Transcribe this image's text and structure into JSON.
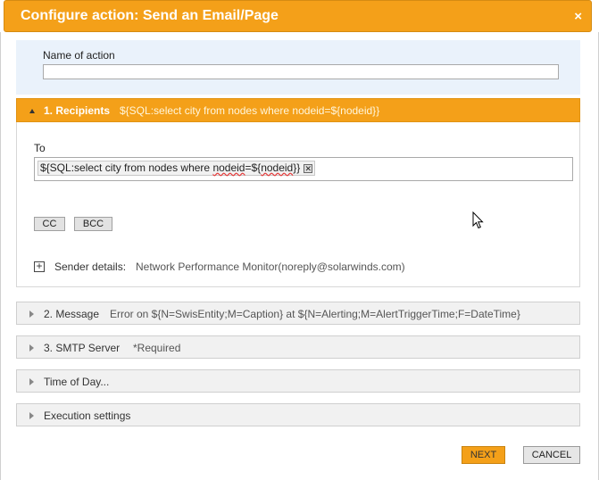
{
  "dialog": {
    "title": "Configure action: Send an Email/Page",
    "close_symbol": "×"
  },
  "name_field": {
    "label": "Name of action",
    "value": ""
  },
  "recipients": {
    "title": "1. Recipients",
    "summary": "${SQL:select city from nodes where nodeid=${nodeid}}",
    "to_label": "To",
    "chip_prefix": "${SQL:select city from nodes where ",
    "chip_sq1": "nodeid",
    "chip_eq": "=${",
    "chip_sq2": "nodeid",
    "chip_suffix": "}}",
    "chip_remove": "✕",
    "cc_label": "CC",
    "bcc_label": "BCC",
    "sender_toggle": "+",
    "sender_label": "Sender details:",
    "sender_value": "Network Performance Monitor(noreply@solarwinds.com)"
  },
  "sections": {
    "message": {
      "title": "2. Message",
      "summary": "Error on ${N=SwisEntity;M=Caption} at ${N=Alerting;M=AlertTriggerTime;F=DateTime}"
    },
    "smtp": {
      "title": "3. SMTP Server",
      "summary": "*Required"
    },
    "time_of_day": {
      "title": "Time of Day..."
    },
    "execution": {
      "title": "Execution settings"
    }
  },
  "buttons": {
    "next": "NEXT",
    "cancel": "CANCEL"
  },
  "colors": {
    "accent": "#f4a019",
    "name_bg": "#eaf2fb",
    "collapsed_bg": "#f1f1f1"
  }
}
